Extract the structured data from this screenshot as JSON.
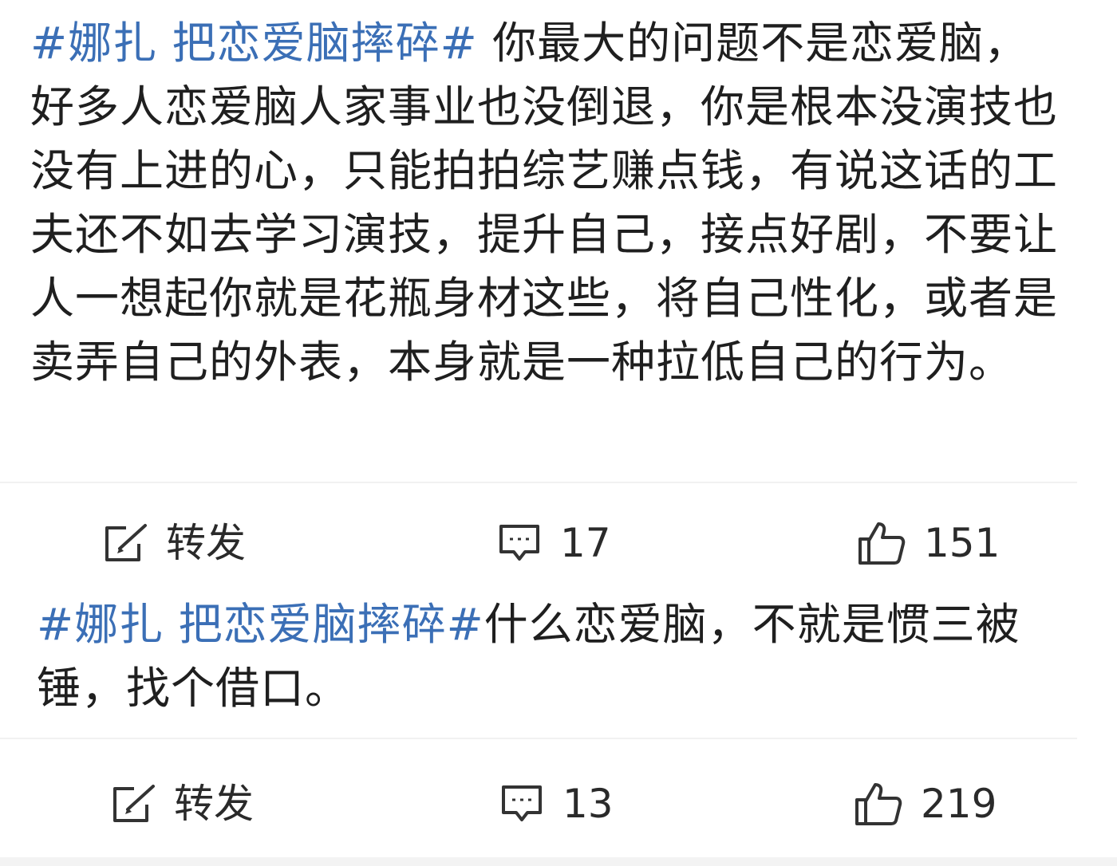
{
  "posts": [
    {
      "hashtag": "#娜扎 把恋爱脑摔碎#",
      "text": " 你最大的问题不是恋爱脑，好多人恋爱脑人家事业也没倒退，你是根本没演技也没有上进的心，只能拍拍综艺赚点钱，有说这话的工夫还不如去学习演技，提升自己，接点好剧，不要让人一想起你就是花瓶身材这些，将自己性化，或者是卖弄自己的外表，本身就是一种拉低自己的行为。",
      "actions": {
        "repost_label": "转发",
        "comment_count": "17",
        "like_count": "151"
      }
    },
    {
      "hashtag": "#娜扎 把恋爱脑摔碎#",
      "text": "什么恋爱脑，不就是惯三被锤，找个借口。",
      "actions": {
        "repost_label": "转发",
        "comment_count": "13",
        "like_count": "219"
      }
    }
  ],
  "icons": {
    "repost": "share-edit-icon",
    "comment": "comment-icon",
    "like": "thumbs-up-icon"
  },
  "colors": {
    "hashtag": "#3b6fb6",
    "text": "#1f1f1f",
    "icon": "#333333"
  }
}
